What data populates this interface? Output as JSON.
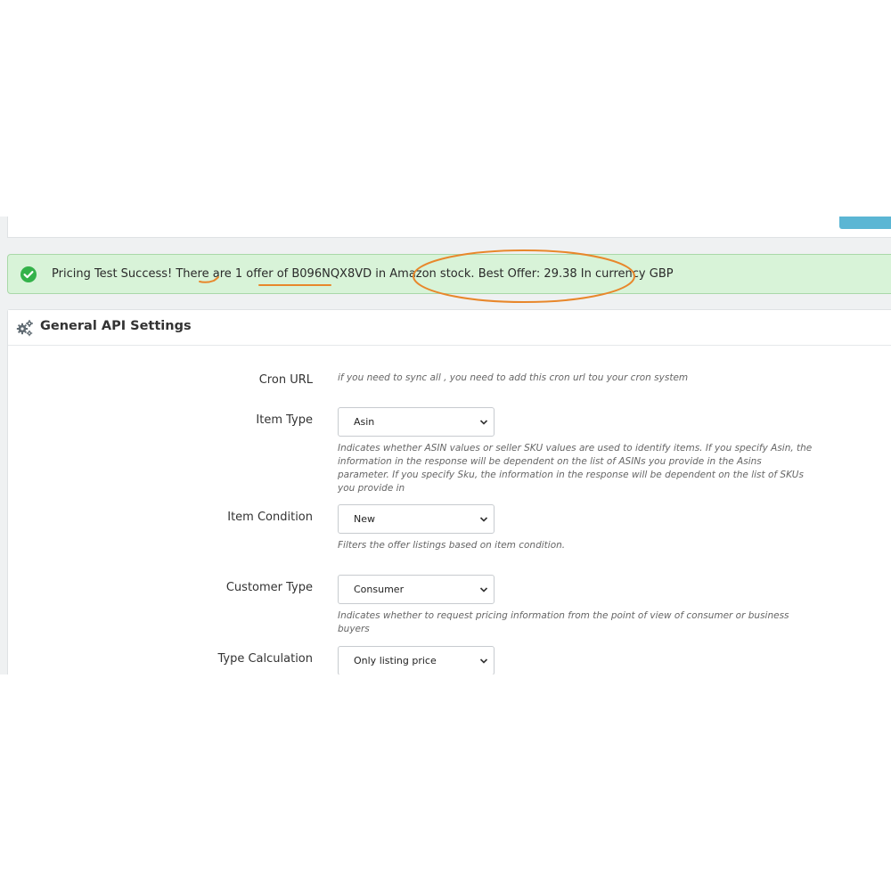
{
  "alert": {
    "segments": [
      "Pricing Test Success! There are ",
      "1",
      " offer of ",
      "B096NQX8VD",
      " in Amazon stock. Best Offer: 29.38 In currency GBP"
    ],
    "color": "#d8f3d8",
    "icon": "check-circle-icon"
  },
  "panel": {
    "title": "General API Settings",
    "icon": "gears-icon"
  },
  "fields": {
    "cron_url": {
      "label": "Cron URL",
      "help": "if you need to sync all , you need to add this cron url tou your cron system"
    },
    "item_type": {
      "label": "Item Type",
      "value": "Asin",
      "help": "Indicates whether ASIN values or seller SKU values are used to identify items. If you specify Asin, the information in the response will be dependent on the list of ASINs you provide in the Asins parameter. If you specify Sku, the information in the response will be dependent on the list of SKUs you provide in"
    },
    "item_condition": {
      "label": "Item Condition",
      "value": "New",
      "help": "Filters the offer listings based on item condition."
    },
    "customer_type": {
      "label": "Customer Type",
      "value": "Consumer",
      "help": "Indicates whether to request pricing information from the point of view of consumer or business buyers"
    },
    "type_calculation": {
      "label": "Type Calculation",
      "value": "Only listing price"
    }
  },
  "colors": {
    "annotation": "#e8872b",
    "button_accent": "#5bb6d4",
    "success_icon": "#34b24a"
  }
}
